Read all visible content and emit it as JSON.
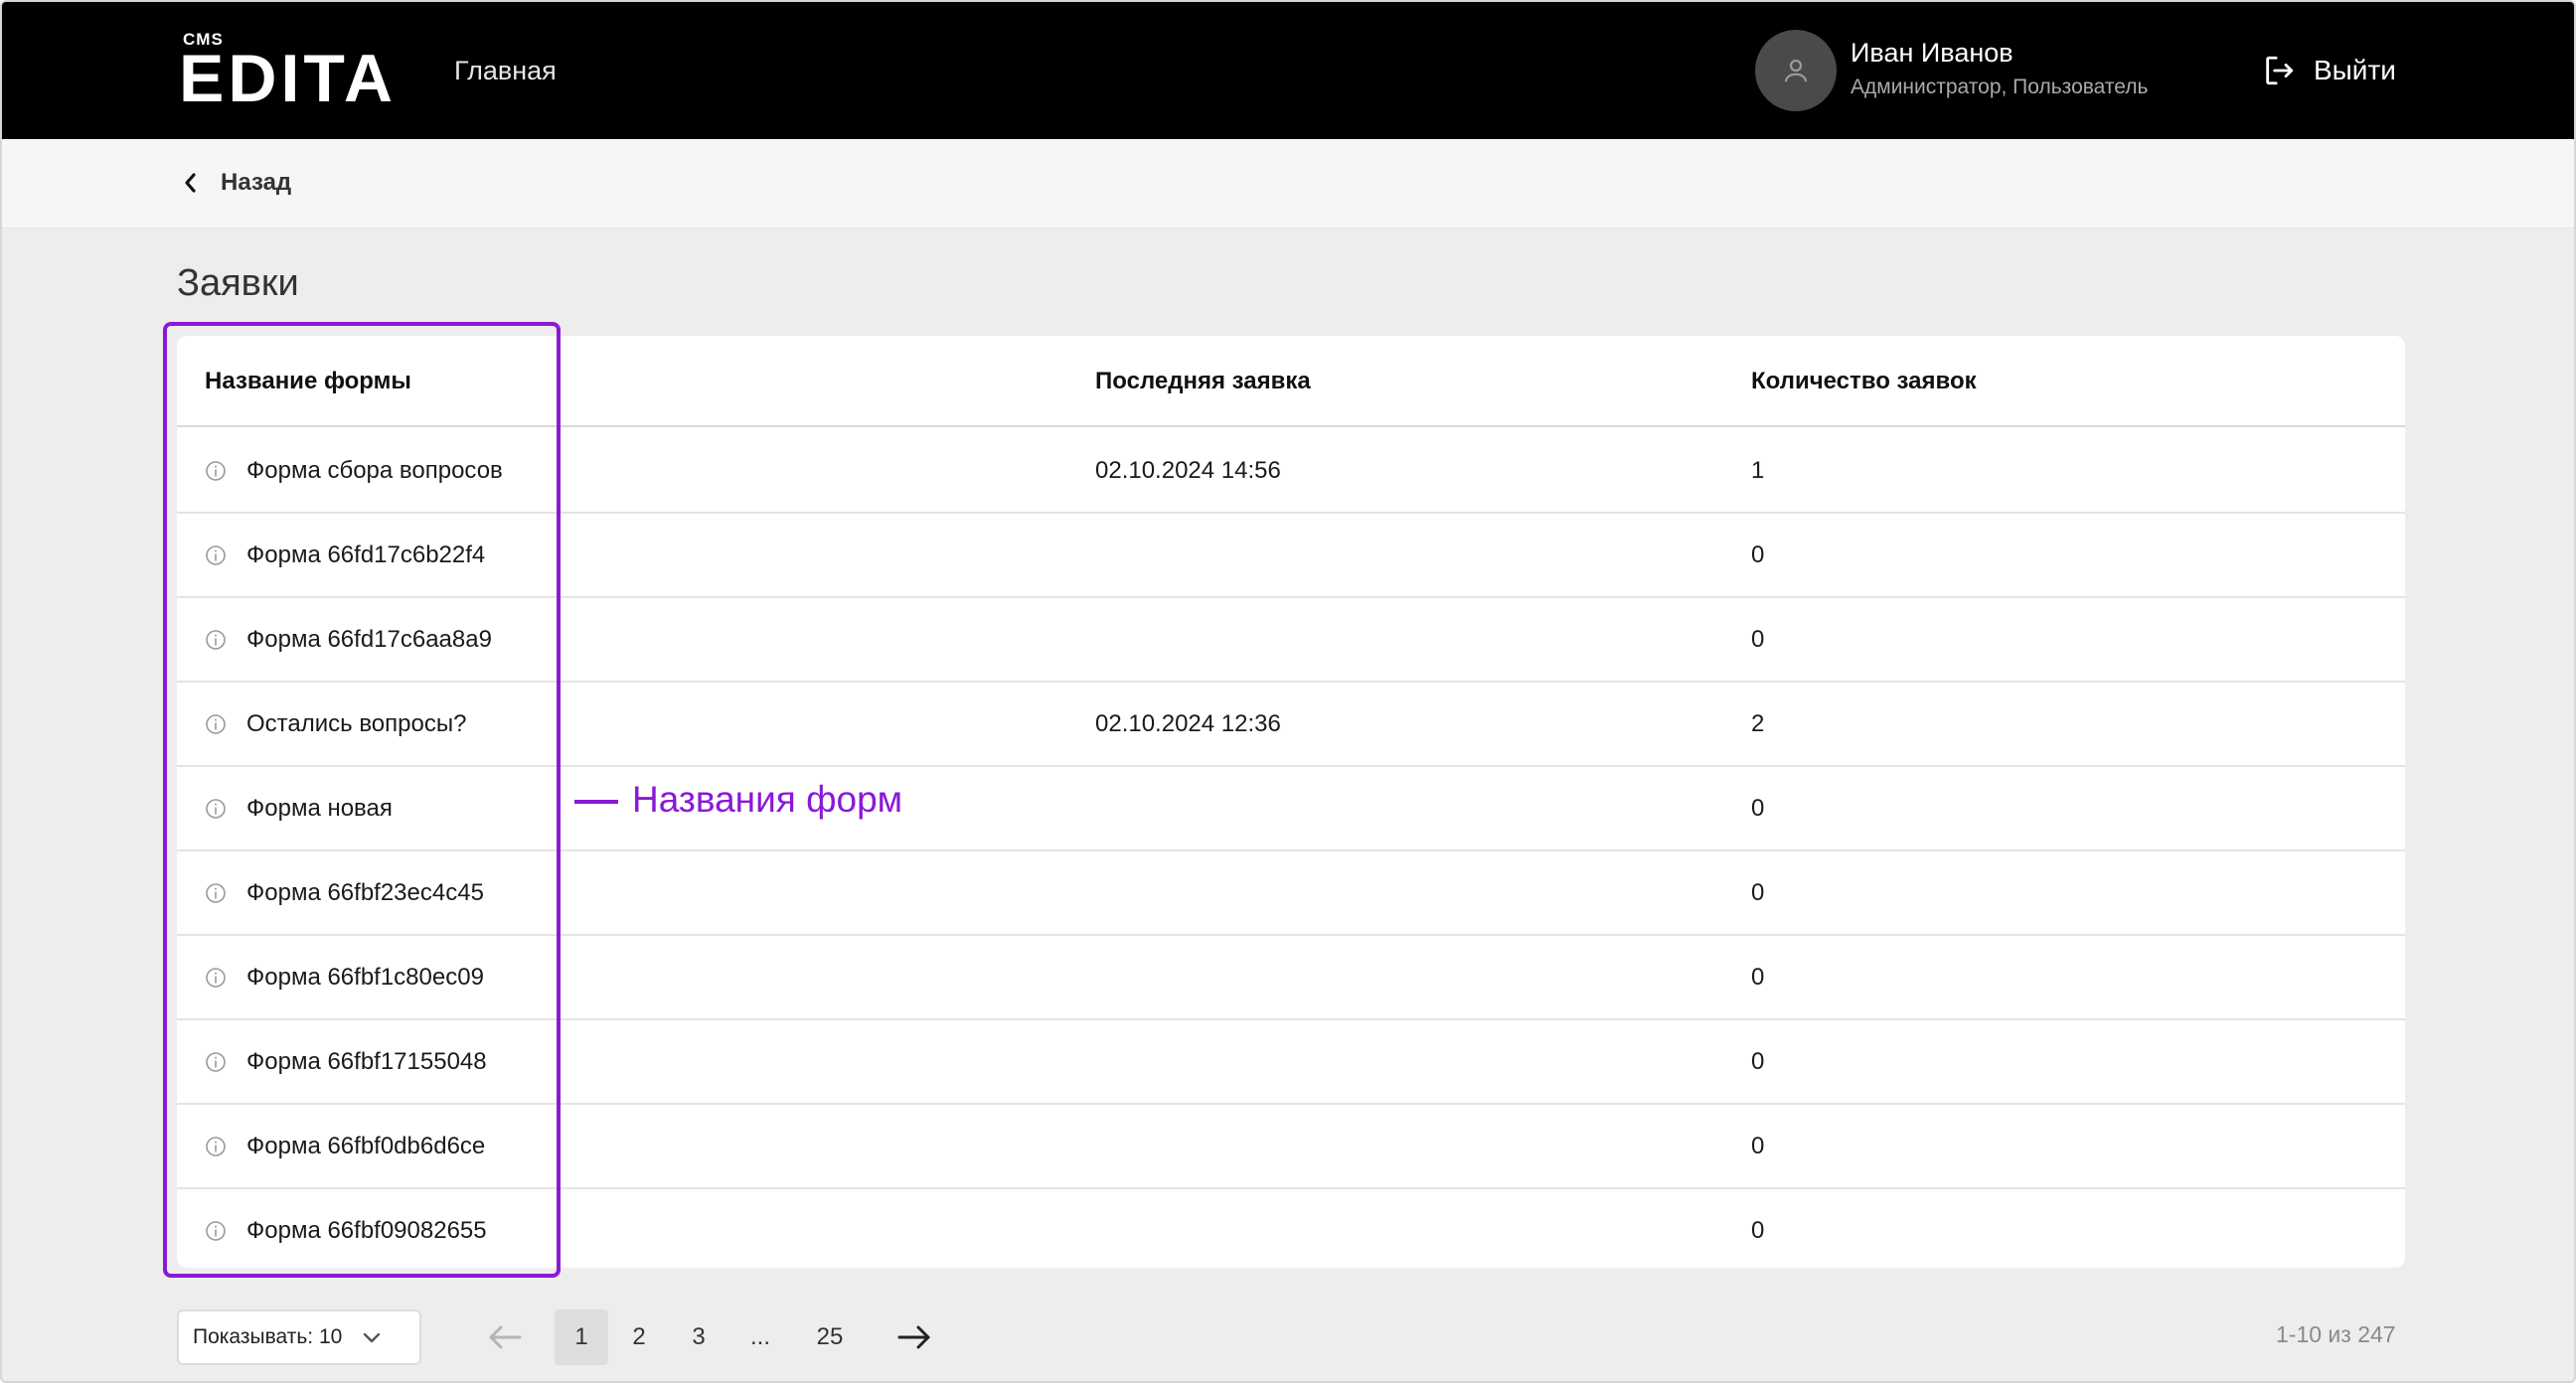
{
  "header": {
    "logo_small": "CMS",
    "logo": "EDITA",
    "nav_home": "Главная",
    "user_name": "Иван Иванов",
    "user_role": "Администратор, Пользователь",
    "logout_label": "Выйти",
    "avatar_icon": "user-icon",
    "logout_icon": "logout-icon"
  },
  "subbar": {
    "back_label": "Назад",
    "back_icon": "chevron-left-icon"
  },
  "page": {
    "title": "Заявки"
  },
  "table": {
    "headers": [
      "Название формы",
      "Последняя заявка",
      "Количество заявок"
    ],
    "rows": [
      {
        "name": "Форма сбора вопросов",
        "last": "02.10.2024 14:56",
        "count": "1"
      },
      {
        "name": "Форма 66fd17c6b22f4",
        "last": "",
        "count": "0"
      },
      {
        "name": "Форма 66fd17c6aa8a9",
        "last": "",
        "count": "0"
      },
      {
        "name": "Остались вопросы?",
        "last": "02.10.2024 12:36",
        "count": "2"
      },
      {
        "name": "Форма новая",
        "last": "",
        "count": "0"
      },
      {
        "name": "Форма 66fbf23ec4c45",
        "last": "",
        "count": "0"
      },
      {
        "name": "Форма 66fbf1c80ec09",
        "last": "",
        "count": "0"
      },
      {
        "name": "Форма 66fbf17155048",
        "last": "",
        "count": "0"
      },
      {
        "name": "Форма 66fbf0db6d6ce",
        "last": "",
        "count": "0"
      },
      {
        "name": "Форма 66fbf09082655",
        "last": "",
        "count": "0"
      }
    ],
    "row_icon": "info-icon"
  },
  "annotation": {
    "label": "Названия форм",
    "color": "#8a19d6"
  },
  "pagination": {
    "per_page_label": "Показывать: 10",
    "pages": [
      "1",
      "2",
      "3",
      "...",
      "25"
    ],
    "current": "1",
    "summary": "1-10 из 247"
  }
}
